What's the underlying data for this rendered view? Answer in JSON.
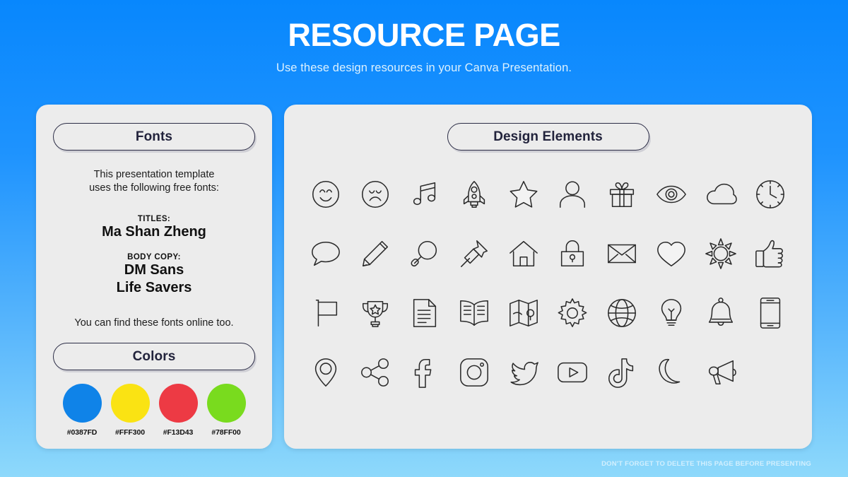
{
  "header": {
    "title": "RESOURCE PAGE",
    "subtitle": "Use these design resources in your Canva Presentation."
  },
  "fonts_panel": {
    "heading": "Fonts",
    "intro_line1": "This presentation template",
    "intro_line2": "uses the following free fonts:",
    "titles_label": "TITLES:",
    "titles_font": "Ma Shan Zheng",
    "body_label": "BODY COPY:",
    "body_font_1": "DM Sans",
    "body_font_2": "Life Savers",
    "outro": "You can find these fonts online too."
  },
  "colors_panel": {
    "heading": "Colors",
    "swatches": [
      {
        "hex_label": "#0387FD",
        "color": "#0F83E8"
      },
      {
        "hex_label": "#FFF300",
        "color": "#FAE313"
      },
      {
        "hex_label": "#F13D43",
        "color": "#ED3A44"
      },
      {
        "hex_label": "#78FF00",
        "color": "#79DB1E"
      }
    ]
  },
  "design_panel": {
    "heading": "Design Elements",
    "icons": [
      {
        "name": "smiley-face-icon"
      },
      {
        "name": "sad-face-icon"
      },
      {
        "name": "music-note-icon"
      },
      {
        "name": "rocket-icon"
      },
      {
        "name": "star-icon"
      },
      {
        "name": "person-icon"
      },
      {
        "name": "gift-icon"
      },
      {
        "name": "eye-icon"
      },
      {
        "name": "cloud-icon"
      },
      {
        "name": "clock-icon"
      },
      {
        "name": "speech-bubble-icon"
      },
      {
        "name": "pencil-icon"
      },
      {
        "name": "magnifier-icon"
      },
      {
        "name": "pushpin-icon"
      },
      {
        "name": "house-icon"
      },
      {
        "name": "lock-icon"
      },
      {
        "name": "envelope-icon"
      },
      {
        "name": "heart-icon"
      },
      {
        "name": "sun-icon"
      },
      {
        "name": "thumbs-up-icon"
      },
      {
        "name": "flag-icon"
      },
      {
        "name": "trophy-icon"
      },
      {
        "name": "document-icon"
      },
      {
        "name": "book-icon"
      },
      {
        "name": "map-icon"
      },
      {
        "name": "gear-icon"
      },
      {
        "name": "globe-icon"
      },
      {
        "name": "lightbulb-icon"
      },
      {
        "name": "bell-icon"
      },
      {
        "name": "phone-icon"
      },
      {
        "name": "location-pin-icon"
      },
      {
        "name": "share-icon"
      },
      {
        "name": "facebook-icon"
      },
      {
        "name": "instagram-icon"
      },
      {
        "name": "twitter-icon"
      },
      {
        "name": "youtube-icon"
      },
      {
        "name": "tiktok-icon"
      },
      {
        "name": "moon-icon"
      },
      {
        "name": "megaphone-icon"
      }
    ]
  },
  "footer": {
    "note": "DON'T FORGET TO DELETE THIS PAGE BEFORE PRESENTING"
  }
}
